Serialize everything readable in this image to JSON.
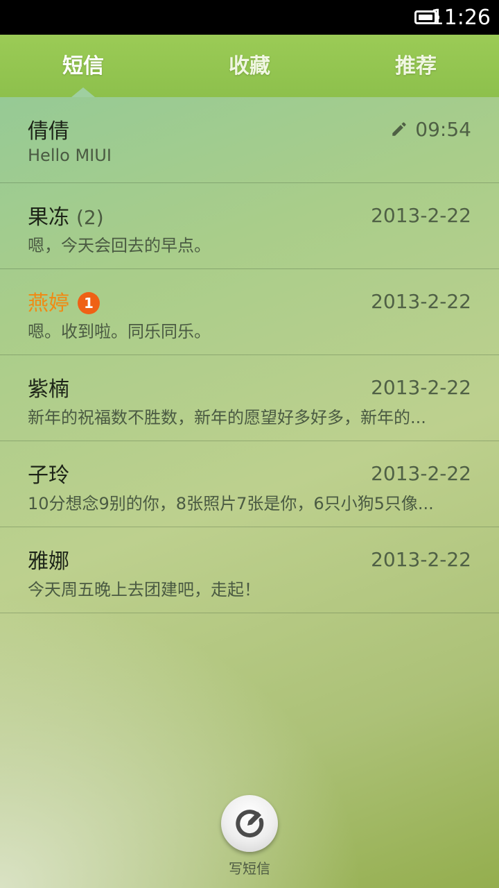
{
  "status_bar": {
    "time": "11:26",
    "battery_icon": "battery-full-icon"
  },
  "tabs": [
    {
      "label": "短信",
      "active": true
    },
    {
      "label": "收藏",
      "active": false
    },
    {
      "label": "推荐",
      "active": false
    }
  ],
  "messages": [
    {
      "name": "倩倩",
      "count": "",
      "unread_badge": "",
      "time": "09:54",
      "draft": true,
      "preview": "Hello MIUI"
    },
    {
      "name": "果冻",
      "count": "(2)",
      "unread_badge": "",
      "time": "2013-2-22",
      "draft": false,
      "preview": "嗯，今天会回去的早点。"
    },
    {
      "name": "燕婷",
      "count": "",
      "unread_badge": "1",
      "time": "2013-2-22",
      "draft": false,
      "preview": "嗯。收到啦。同乐同乐。"
    },
    {
      "name": "紫楠",
      "count": "",
      "unread_badge": "",
      "time": "2013-2-22",
      "draft": false,
      "preview": "新年的祝福数不胜数，新年的愿望好多好多，新年的..."
    },
    {
      "name": "子玲",
      "count": "",
      "unread_badge": "",
      "time": "2013-2-22",
      "draft": false,
      "preview": "10分想念9别的你，8张照片7张是你，6只小狗5只像..."
    },
    {
      "name": "雅娜",
      "count": "",
      "unread_badge": "",
      "time": "2013-2-22",
      "draft": false,
      "preview": "今天周五晚上去团建吧，走起！"
    }
  ],
  "compose": {
    "label": "写短信",
    "icon": "compose-icon"
  },
  "colors": {
    "tab_bar": "#8dc04c",
    "unread_name": "#f08a14",
    "unread_badge": "#ef6115"
  }
}
